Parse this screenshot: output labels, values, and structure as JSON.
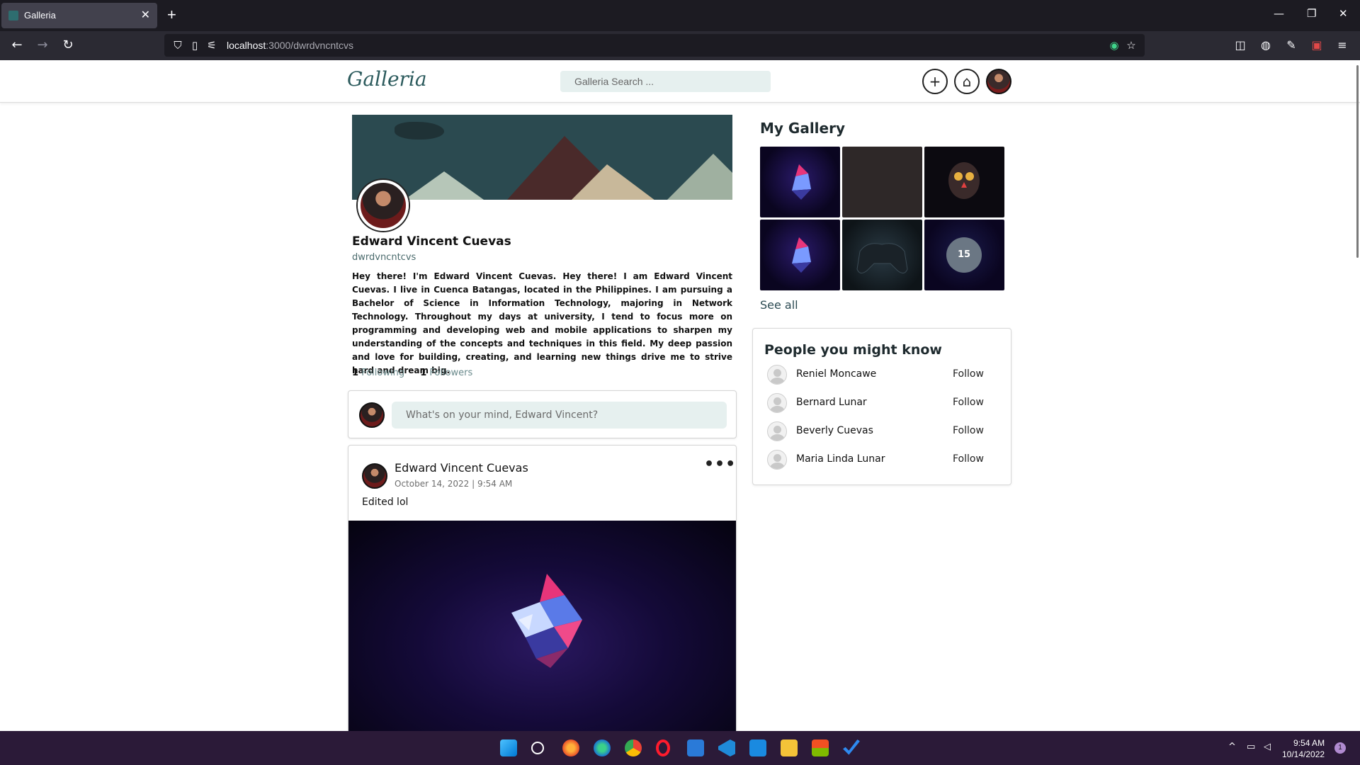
{
  "browser": {
    "tab_title": "Galleria",
    "tab_close": "✕",
    "new_tab": "+",
    "url_host": "localhost",
    "url_path": ":3000/dwrdvncntcvs"
  },
  "app": {
    "logo": "Galleria",
    "search_placeholder": "Galleria Search ...",
    "add_icon": "+",
    "home_icon": "⌂"
  },
  "profile": {
    "name": "Edward Vincent Cuevas",
    "username": "dwrdvncntcvs",
    "bio": "Hey there! I'm Edward Vincent Cuevas. Hey there! I am Edward Vincent Cuevas. I live in Cuenca Batangas, located in the Philippines. I am pursuing a Bachelor of Science in Information Technology, majoring in Network Technology. Throughout my days at university, I tend to focus more on programming and developing web and mobile applications to sharpen my understanding of the concepts and techniques in this field. My deep passion and love for building, creating, and learning new things drive me to strive hard and dream big.",
    "following_count": "1",
    "following_label": "Following",
    "followers_count": "1",
    "followers_label": "Followers"
  },
  "composer": {
    "placeholder": "What's on your mind, Edward Vincent?"
  },
  "post": {
    "author": "Edward Vincent Cuevas",
    "date": "October 14, 2022 | 9:54 AM",
    "more": "•••",
    "text": "Edited lol"
  },
  "gallery": {
    "title": "My Gallery",
    "more_count": "15",
    "see_all": "See all"
  },
  "people": {
    "title": "People you might know",
    "items": [
      {
        "name": "Reniel Moncawe",
        "action": "Follow"
      },
      {
        "name": "Bernard Lunar",
        "action": "Follow"
      },
      {
        "name": "Beverly Cuevas",
        "action": "Follow"
      },
      {
        "name": "Maria Linda Lunar",
        "action": "Follow"
      }
    ]
  },
  "taskbar": {
    "time": "9:54 AM",
    "date": "10/14/2022",
    "notification_count": "1"
  },
  "colors": {
    "accent": "#2b5a5c",
    "search_bg": "#e6f0ef",
    "taskbar_bg": "#2b1a38"
  }
}
